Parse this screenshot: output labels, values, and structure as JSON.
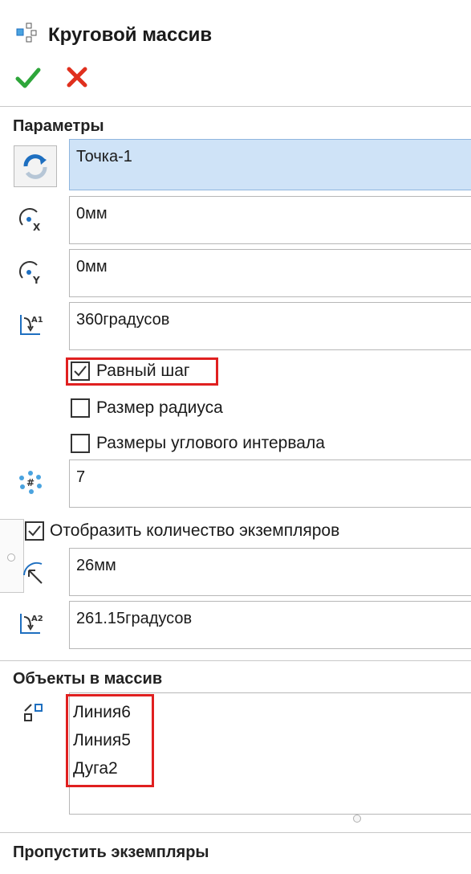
{
  "header": {
    "title": "Круговой массив",
    "icon": "circular-pattern-icon"
  },
  "actions": {
    "ok_icon": "checkmark-icon",
    "cancel_icon": "close-icon",
    "ok_color": "#2ea63a",
    "cancel_color": "#e0301e"
  },
  "parameters": {
    "section_title": "Параметры",
    "center_point": "Точка-1",
    "center_x": "0мм",
    "center_y": "0мм",
    "angle": "360градусов",
    "equal_spacing": {
      "label": "Равный шаг",
      "checked": true
    },
    "radius_dim": {
      "label": "Размер радиуса",
      "checked": false
    },
    "angle_dim": {
      "label": "Размеры углового интервала",
      "checked": false
    },
    "count": "7",
    "show_count": {
      "label": "Отобразить количество экземпляров",
      "checked": true
    },
    "radius": "26мм",
    "arc_angle": "261.15градусов"
  },
  "entities": {
    "section_title": "Объекты в массив",
    "items": [
      "Линия6",
      "Линия5",
      "Дуга2"
    ]
  },
  "skip": {
    "section_title": "Пропустить экземпляры"
  },
  "colors": {
    "highlight_box": "#e02020",
    "selected_field": "#cfe3f7",
    "icon_blue": "#1e6fc0"
  }
}
